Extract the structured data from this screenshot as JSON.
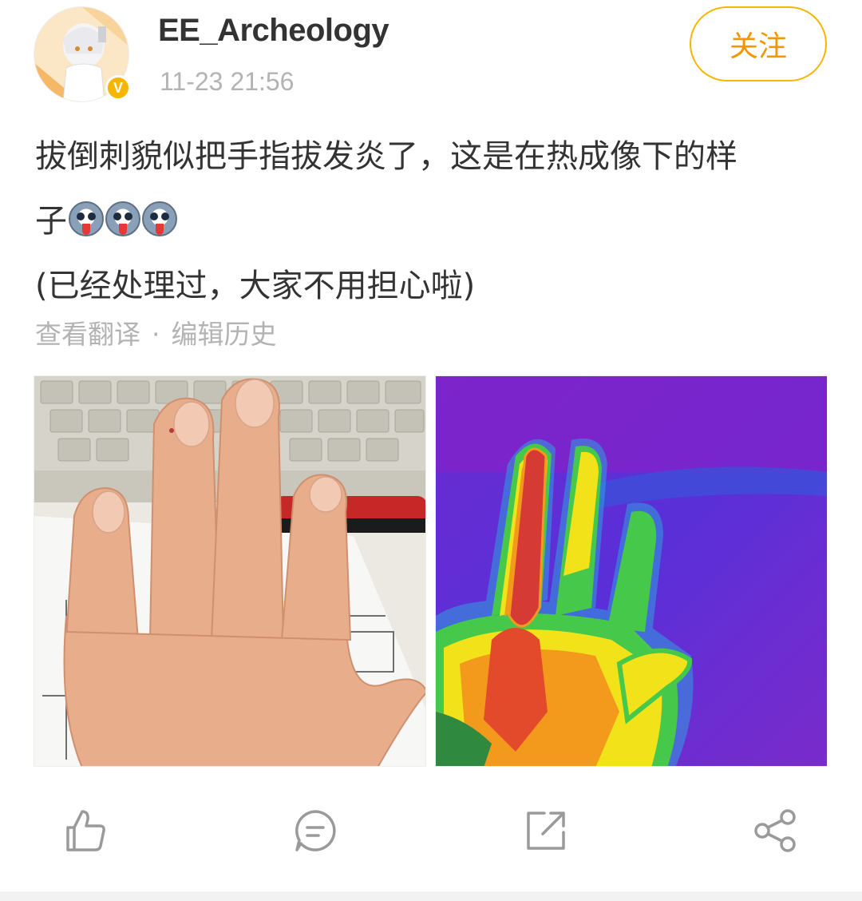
{
  "author": {
    "name": "EE_Archeology",
    "timestamp": "11-23 21:56",
    "verified_badge": "V",
    "follow_label": "关注"
  },
  "post": {
    "line1": "拔倒刺貌似把手指拔发炎了，这是在热成像下的样",
    "line2": "子",
    "line3": "(已经处理过，大家不用担心啦)",
    "emojis": [
      "husky-emoji",
      "husky-emoji",
      "husky-emoji"
    ]
  },
  "links": {
    "translate": "查看翻译",
    "separator": "·",
    "edit_history": "编辑历史"
  },
  "images": [
    {
      "name": "photo-hand",
      "icon": "photo"
    },
    {
      "name": "photo-thermal-hand",
      "icon": "photo"
    }
  ],
  "actions": [
    {
      "name": "like",
      "icon": "thumbs-up-icon"
    },
    {
      "name": "comment",
      "icon": "comment-icon"
    },
    {
      "name": "repost",
      "icon": "repost-icon"
    },
    {
      "name": "share",
      "icon": "share-icon"
    }
  ],
  "colors": {
    "accent": "#f7b500",
    "follow_text": "#f39700",
    "meta_text": "#b3b3b3",
    "body_text": "#333333"
  }
}
